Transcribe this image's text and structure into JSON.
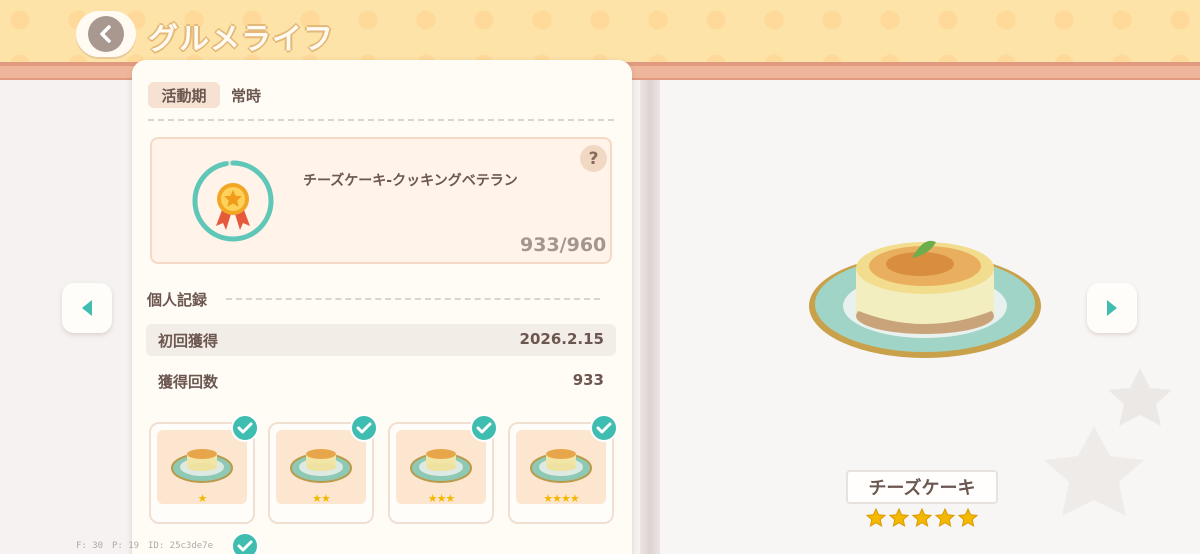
{
  "header": {
    "title": "グルメライフ"
  },
  "period": {
    "label": "活動期",
    "value": "常時"
  },
  "achievement": {
    "name": "チーズケーキ-クッキングベテラン",
    "progress_text": "933/960",
    "progress_fraction": 0.97,
    "help_label": "?"
  },
  "records": {
    "title": "個人記録",
    "rows": [
      {
        "label": "初回獲得",
        "value": "2026.2.15"
      },
      {
        "label": "獲得回数",
        "value": "933"
      }
    ]
  },
  "tiles": [
    {
      "stars": "★",
      "obtained": true
    },
    {
      "stars": "★★",
      "obtained": true
    },
    {
      "stars": "★★★",
      "obtained": true
    },
    {
      "stars": "★★★★",
      "obtained": true
    }
  ],
  "dish": {
    "name": "チーズケーキ",
    "stars": 5
  },
  "debug": {
    "fps": "F: 30",
    "p": "P: 19",
    "id": "ID: 25c3de7e"
  },
  "colors": {
    "accent": "#3fbdb0",
    "header_bg": "#fde3a8",
    "star": "#f5b800"
  }
}
